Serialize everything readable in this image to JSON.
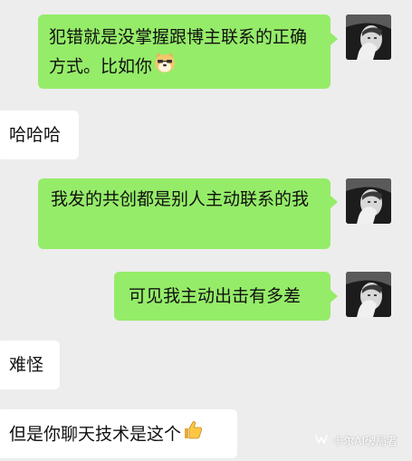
{
  "chat": {
    "messages": [
      {
        "side": "sent",
        "text": "犯错就是没掌握跟博主联系的正确方式。比如你",
        "emoji": "doge-emoji"
      },
      {
        "side": "received",
        "text": "哈哈哈"
      },
      {
        "side": "sent",
        "text": "我发的共创都是别人主动联系的我"
      },
      {
        "side": "sent",
        "text": "可见我主动出击有多差"
      },
      {
        "side": "received",
        "text": "难怪"
      },
      {
        "side": "received",
        "text": "但是你聊天技术是这个",
        "emoji": "thumbs-up-emoji"
      }
    ]
  },
  "watermark": {
    "text": "卡尔AI破局者",
    "icon": "wechat-channel-icon"
  },
  "colors": {
    "background": "#ededed",
    "sent_bubble": "#95ec69",
    "received_bubble": "#ffffff"
  }
}
